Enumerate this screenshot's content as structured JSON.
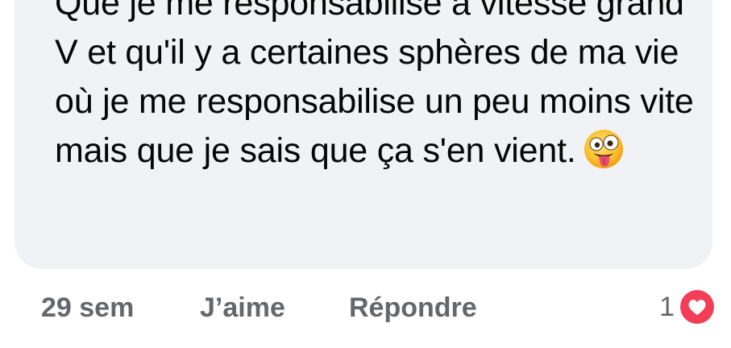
{
  "comment": {
    "text": "Que je me responsabilise à vitesse grand V et qu'il y a certaines sphères de ma vie où je me responsabilise un peu moins vite mais que je sais que ça s'en vient.",
    "emoji": "zany-face-tongue-out"
  },
  "footer": {
    "time": "29 sem",
    "like_label": "J’aime",
    "reply_label": "Répondre"
  },
  "reactions": {
    "count": "1",
    "type": "love-heart-icon",
    "color": "#f33e58"
  },
  "colors": {
    "bubble": "#f0f2f5",
    "text": "#050505",
    "meta": "#65676b"
  }
}
